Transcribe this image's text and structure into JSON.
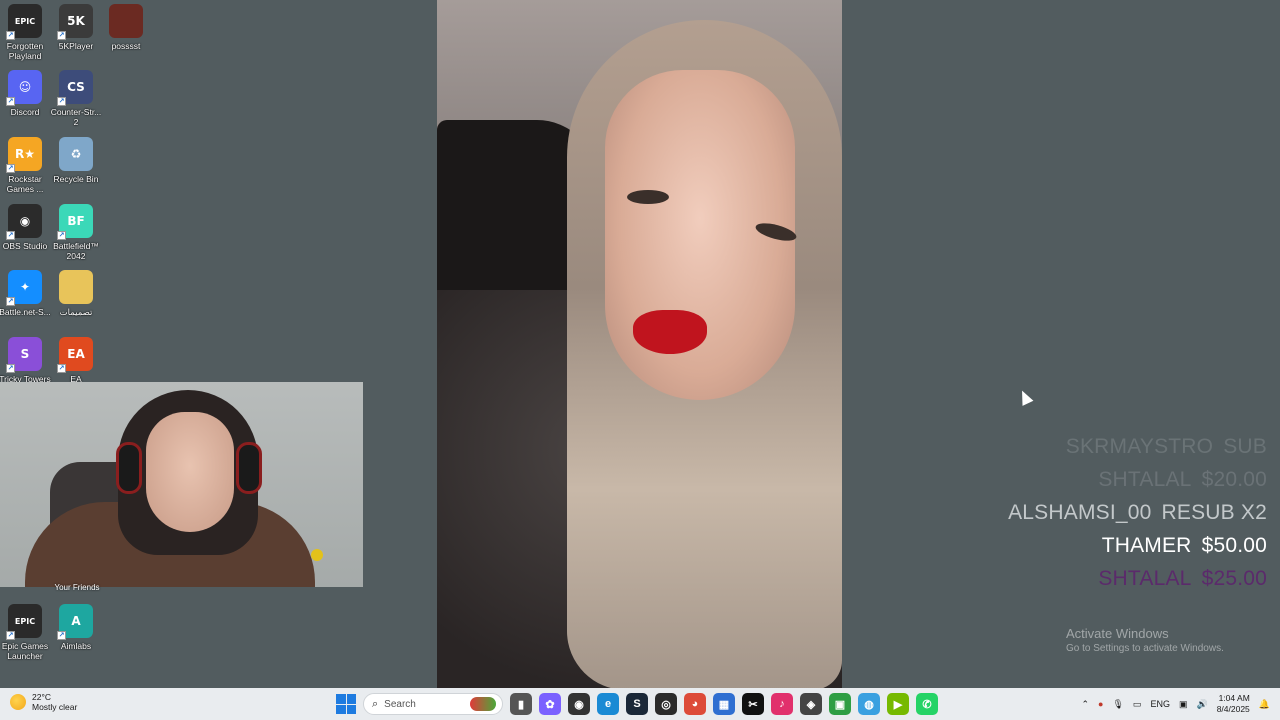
{
  "desktop_icons": [
    {
      "label": "Forgotten\nPlayland",
      "icon": "epic-games-icon",
      "glyph": "EPIC",
      "color": "#2a2a2a"
    },
    {
      "label": "5KPlayer",
      "icon": "5kplayer-icon",
      "glyph": "5K",
      "color": "#3b3b3b"
    },
    {
      "label": "posssst",
      "icon": "image-file-icon",
      "glyph": "",
      "color": "#6b2a22"
    },
    {
      "label": "Discord",
      "icon": "discord-icon",
      "glyph": "☺",
      "color": "#5865f2"
    },
    {
      "label": "Counter-Str...\n2",
      "icon": "counter-strike-icon",
      "glyph": "CS",
      "color": "#3d4c7a"
    },
    {
      "label": "Rockstar\nGames ...",
      "icon": "rockstar-icon",
      "glyph": "R★",
      "color": "#f5a623"
    },
    {
      "label": "Recycle Bin",
      "icon": "recycle-bin-icon",
      "glyph": "♻",
      "color": "#7fa7c9"
    },
    {
      "label": "OBS Studio",
      "icon": "obs-icon",
      "glyph": "◉",
      "color": "#2b2b2b"
    },
    {
      "label": "Battlefield™\n2042",
      "icon": "battlefield-icon",
      "glyph": "BF",
      "color": "#3bd8b8"
    },
    {
      "label": "Battle.net-S...",
      "icon": "battlenet-icon",
      "glyph": "✦",
      "color": "#148eff"
    },
    {
      "label": "تصميمات",
      "icon": "folder-icon",
      "glyph": "",
      "color": "#e8c45a"
    },
    {
      "label": "Tricky Towers",
      "icon": "tricky-towers-icon",
      "glyph": "S",
      "color": "#8a4fd8"
    },
    {
      "label": "EA",
      "icon": "ea-icon",
      "glyph": "EA",
      "color": "#e04a1f"
    },
    {
      "label": "Epic Games\nLauncher",
      "icon": "epic-launcher-icon",
      "glyph": "EPIC",
      "color": "#2a2a2a"
    },
    {
      "label": "Aimlabs",
      "icon": "aimlabs-icon",
      "glyph": "A",
      "color": "#1ea7a0"
    }
  ],
  "webcam_caption": "Your Friends",
  "alerts": [
    {
      "name": "SKRMAYSTRO",
      "value": "SUB",
      "color": "#6a7376"
    },
    {
      "name": "SHTALAL",
      "value": "$20.00",
      "color": "#6a7276"
    },
    {
      "name": "ALSHAMSI_00",
      "value": "RESUB X2",
      "color": "#c3c8ca"
    },
    {
      "name": "THAMER",
      "value": "$50.00",
      "color": "#ffffff"
    },
    {
      "name": "SHTALAL",
      "value": "$25.00",
      "color": "#5b2a6b"
    }
  ],
  "activate": {
    "title": "Activate Windows",
    "subtitle": "Go to Settings to activate Windows."
  },
  "taskbar": {
    "weather_temp": "22°C",
    "weather_desc": "Mostly clear",
    "search_placeholder": "Search",
    "apps": [
      {
        "icon": "file-explorer-icon",
        "glyph": "▮",
        "color": "#555555"
      },
      {
        "icon": "copilot-icon",
        "glyph": "✿",
        "color": "#7b61ff"
      },
      {
        "icon": "obs-taskbar-icon",
        "glyph": "◉",
        "color": "#333333"
      },
      {
        "icon": "edge-icon",
        "glyph": "e",
        "color": "#1a8ad4"
      },
      {
        "icon": "steam-icon",
        "glyph": "S",
        "color": "#1b2838"
      },
      {
        "icon": "record-icon",
        "glyph": "◎",
        "color": "#2b2b2b"
      },
      {
        "icon": "chrome-icon",
        "glyph": "◕",
        "color": "#dd4b39"
      },
      {
        "icon": "store-icon",
        "glyph": "▦",
        "color": "#2f6fd1"
      },
      {
        "icon": "capcut-icon",
        "glyph": "✂",
        "color": "#111111"
      },
      {
        "icon": "tiktok-icon",
        "glyph": "♪",
        "color": "#e1306c"
      },
      {
        "icon": "game-icon",
        "glyph": "◈",
        "color": "#444444"
      },
      {
        "icon": "greenapp-icon",
        "glyph": "▣",
        "color": "#2f9e44"
      },
      {
        "icon": "blueapp-icon",
        "glyph": "◍",
        "color": "#3aa0e0"
      },
      {
        "icon": "nvidia-icon",
        "glyph": "▶",
        "color": "#76b900"
      },
      {
        "icon": "whatsapp-icon",
        "glyph": "✆",
        "color": "#25d366"
      }
    ],
    "lang": "ENG",
    "time": "1:04 AM",
    "date": "8/4/2025"
  }
}
